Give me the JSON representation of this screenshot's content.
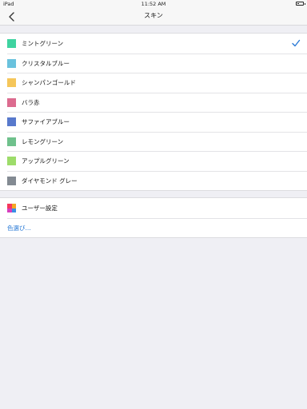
{
  "status": {
    "device": "iPad",
    "time": "11:52 AM"
  },
  "nav": {
    "title": "スキン",
    "back_icon": "chevron-left-icon"
  },
  "skins": [
    {
      "label": "ミントグリーン",
      "color": "#3fd3a0",
      "selected": true
    },
    {
      "label": "クリスタルブルー",
      "color": "#6ac2dd",
      "selected": false
    },
    {
      "label": "シャンパンゴールド",
      "color": "#f5c65a",
      "selected": false
    },
    {
      "label": "バラ赤",
      "color": "#dc6b8f",
      "selected": false
    },
    {
      "label": "サファイアブルー",
      "color": "#5879cc",
      "selected": false
    },
    {
      "label": "レモングリーン",
      "color": "#6fc18c",
      "selected": false
    },
    {
      "label": "アップルグリーン",
      "color": "#9ddc6a",
      "selected": false
    },
    {
      "label": "ダイヤモンド グレー",
      "color": "#838a92",
      "selected": false
    }
  ],
  "custom": {
    "user_setting_label": "ユーザー設定",
    "user_icon_colors": [
      "#f5375c",
      "#f5a623",
      "#d63fbf",
      "#3a8ee6"
    ],
    "choose_color_label": "色選び..."
  },
  "accent_color": "#2a7ad6"
}
